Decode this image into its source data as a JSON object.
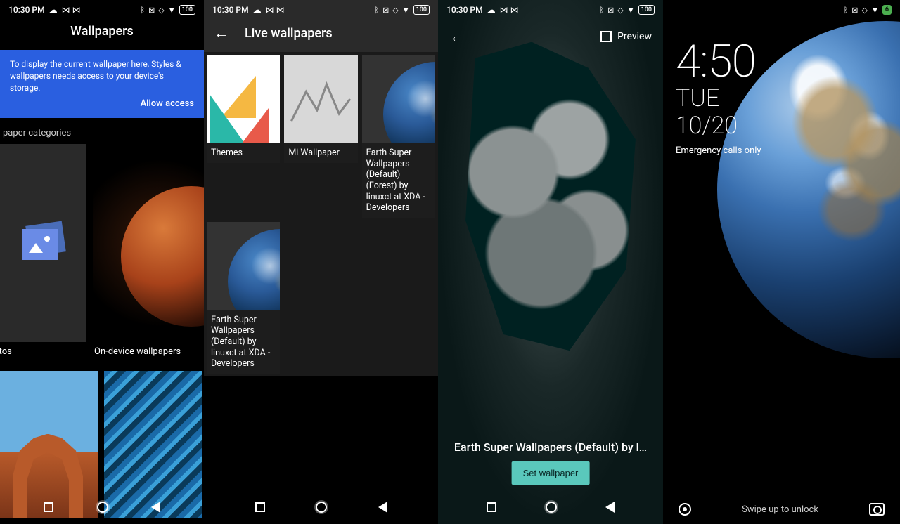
{
  "status": {
    "time": "10:30 PM",
    "battery_full": "100",
    "battery_low": "6"
  },
  "panel1": {
    "title": "Wallpapers",
    "banner_text": "To display the current wallpaper here, Styles & wallpapers needs access to your device's storage.",
    "banner_action": "Allow access",
    "section_label": "paper categories",
    "my_photos": "hotos",
    "on_device": "On-device wallpapers"
  },
  "panel2": {
    "title": "Live wallpapers",
    "items": [
      {
        "label": "Themes"
      },
      {
        "label": "Mi Wallpaper"
      },
      {
        "label": "Earth Super Wallpapers (Default) (Forest) by linuxct at XDA -Developers"
      },
      {
        "label": "Earth Super Wallpapers (Default) by linuxct at XDA -Developers"
      }
    ]
  },
  "panel3": {
    "preview_label": "Preview",
    "wallpaper_name": "Earth Super Wallpapers (Default) by l…",
    "set_button": "Set wallpaper"
  },
  "panel4": {
    "time": "4:50",
    "day": "TUE",
    "date": "10/20",
    "emergency": "Emergency calls only",
    "swipe": "Swipe up to unlock"
  }
}
